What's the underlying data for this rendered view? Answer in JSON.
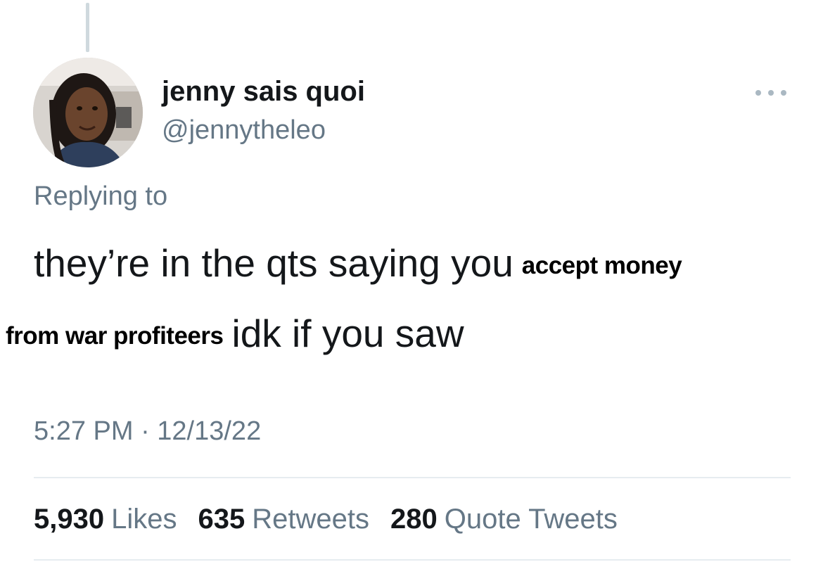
{
  "tweet": {
    "author": {
      "display_name": "jenny sais quoi",
      "handle": "@jennytheleo"
    },
    "replying_to": "Replying to",
    "text": {
      "line1_main": "they’re in the qts saying you",
      "line1_overlay": "accept money",
      "line2_overlay": "from war profiteers",
      "line2_main": "idk if you saw"
    },
    "timestamp": "5:27 PM · 12/13/22",
    "stats": {
      "likes_count": "5,930",
      "likes_label": "Likes",
      "retweets_count": "635",
      "retweets_label": "Retweets",
      "quotes_count": "280",
      "quotes_label": "Quote Tweets"
    },
    "more_icon": "more-horizontal-icon"
  },
  "colors": {
    "primary_text": "#14171a",
    "secondary_text": "#657786",
    "divider": "#e6ecf0"
  }
}
